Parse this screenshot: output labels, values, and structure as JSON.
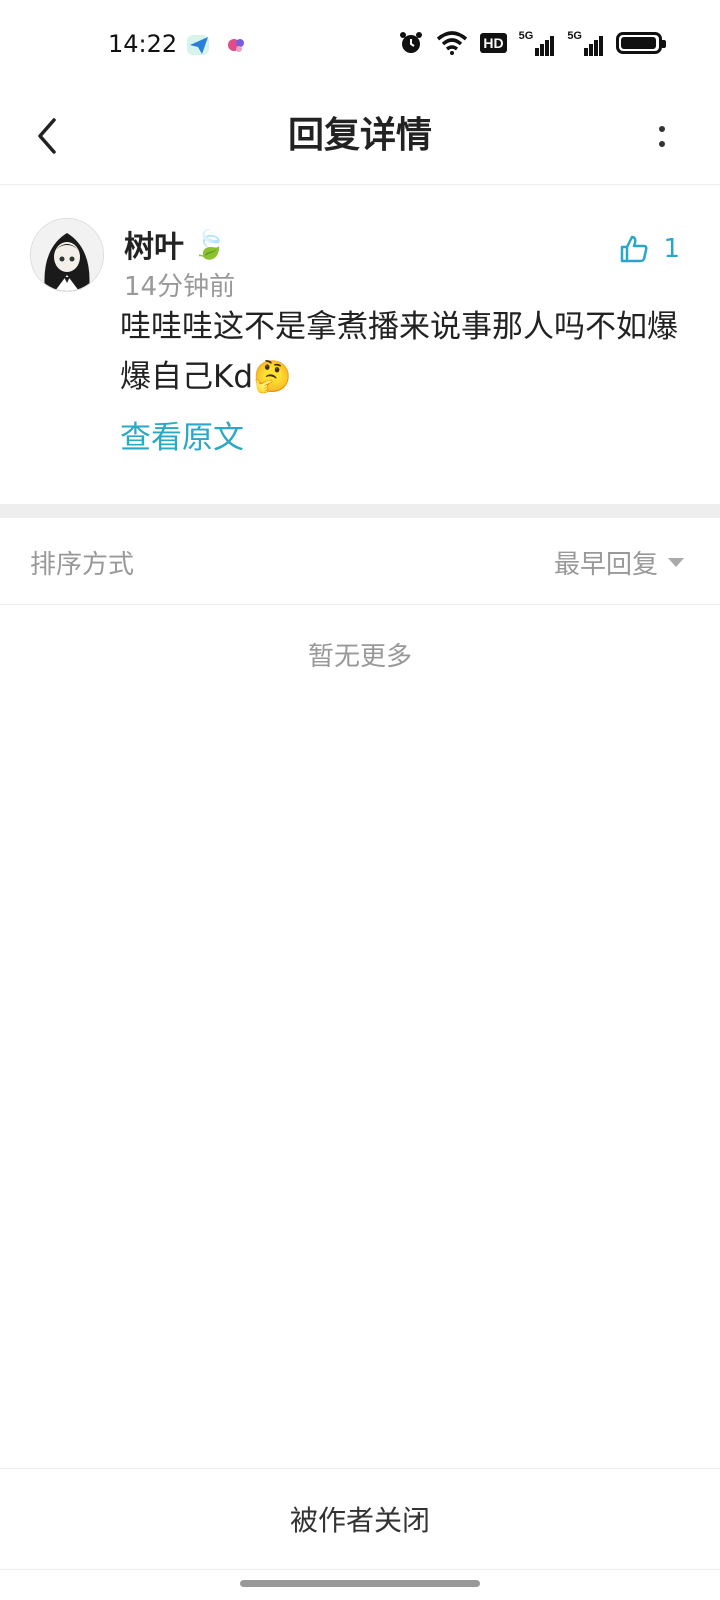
{
  "status_bar": {
    "time": "14:22",
    "hd_label": "HD",
    "signal_1": "5G",
    "signal_2": "5G"
  },
  "nav": {
    "title": "回复详情",
    "back_icon": "chevron-left-icon",
    "more_icon": "more-vertical-icon"
  },
  "comment": {
    "username": "树叶",
    "username_emoji": "🍃",
    "time_ago": "14分钟前",
    "like_count": "1",
    "content": "哇哇哇这不是拿煮播来说事那人吗不如爆爆自己Kd🤔",
    "view_original": "查看原文",
    "accent_color": "#2aa9c4"
  },
  "sort": {
    "label": "排序方式",
    "selected": "最早回复"
  },
  "empty_text": "暂无更多",
  "footer": {
    "text": "被作者关闭"
  }
}
